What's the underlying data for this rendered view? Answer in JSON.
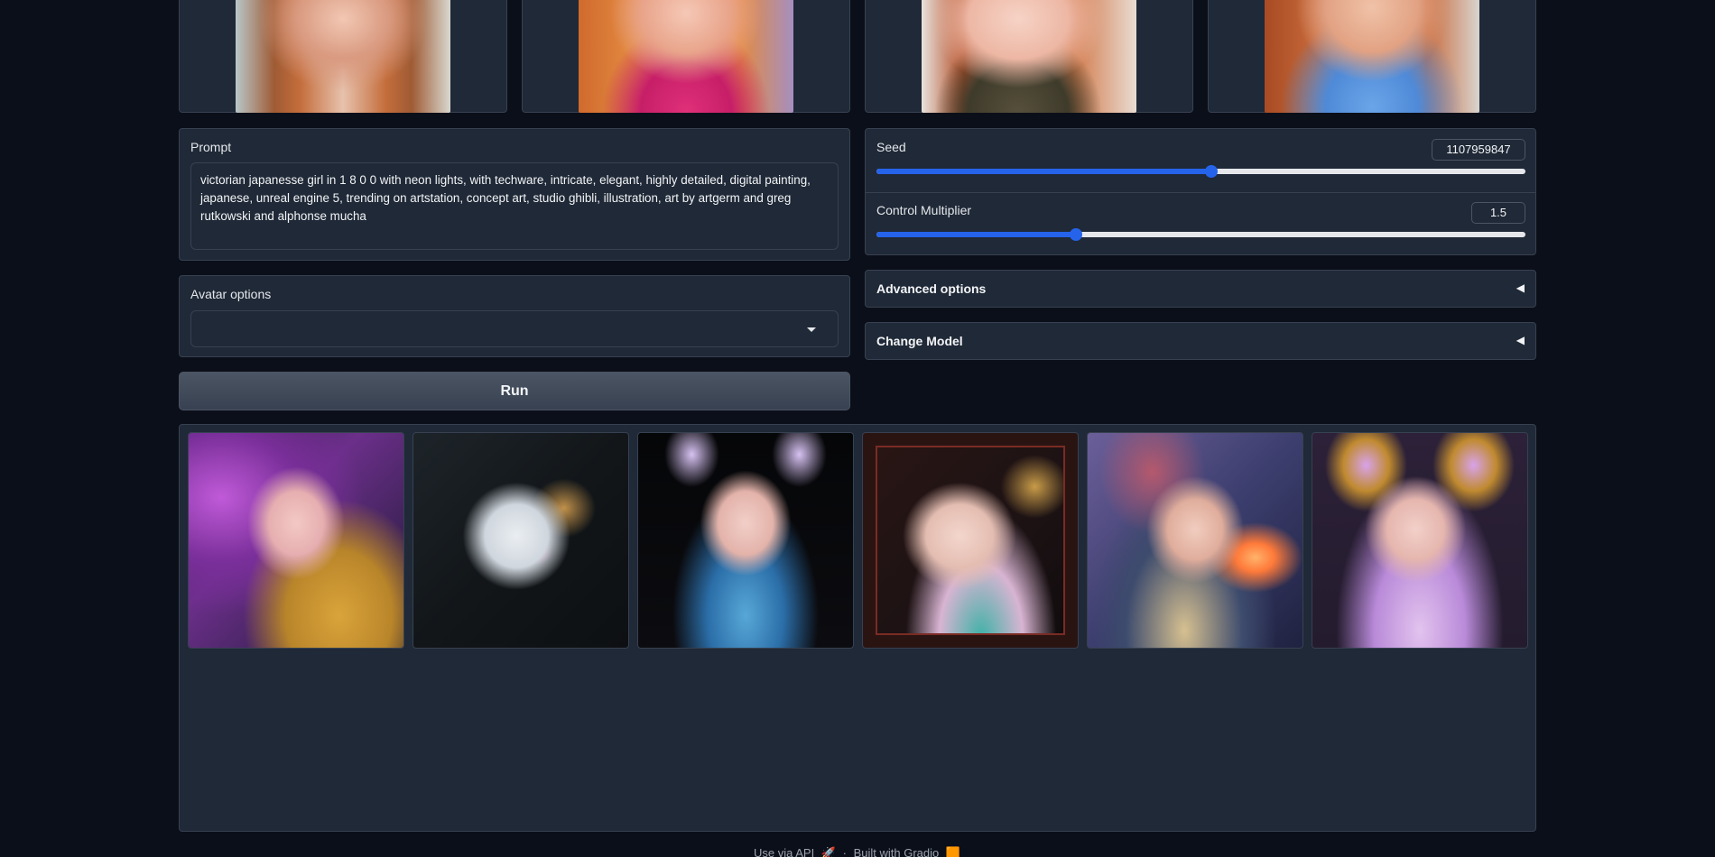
{
  "top_images": [
    {
      "name": "top-image-1"
    },
    {
      "name": "top-image-2"
    },
    {
      "name": "top-image-3"
    },
    {
      "name": "top-image-4"
    }
  ],
  "prompt": {
    "label": "Prompt",
    "value": "victorian japanesse girl in 1 8 0 0 with neon lights, with techware, intricate, elegant, highly detailed, digital painting, japanese, unreal engine 5, trending on artstation, concept art, studio ghibli, illustration, art by artgerm and greg rutkowski and alphonse mucha"
  },
  "seed": {
    "label": "Seed",
    "value": "1107959847",
    "slider_fraction": 0.516
  },
  "control_multiplier": {
    "label": "Control Multiplier",
    "value": "1.5",
    "slider_fraction": 0.307
  },
  "avatar_options": {
    "label": "Avatar options",
    "selected": ""
  },
  "advanced_options": {
    "label": "Advanced options",
    "arrow": "◀"
  },
  "change_model": {
    "label": "Change Model",
    "arrow": "◀"
  },
  "run_button": {
    "label": "Run"
  },
  "gallery": [
    {
      "name": "gallery-image-1"
    },
    {
      "name": "gallery-image-2"
    },
    {
      "name": "gallery-image-3"
    },
    {
      "name": "gallery-image-4"
    },
    {
      "name": "gallery-image-5"
    },
    {
      "name": "gallery-image-6"
    }
  ],
  "footer": {
    "api_link": "Use via API",
    "api_icon": "🚀",
    "separator": "·",
    "built_with": "Built with Gradio",
    "gradio_icon": "🟧"
  },
  "colors": {
    "background": "#0b0f19",
    "panel": "#1f2937",
    "border": "#374151",
    "accent": "#2563eb"
  }
}
